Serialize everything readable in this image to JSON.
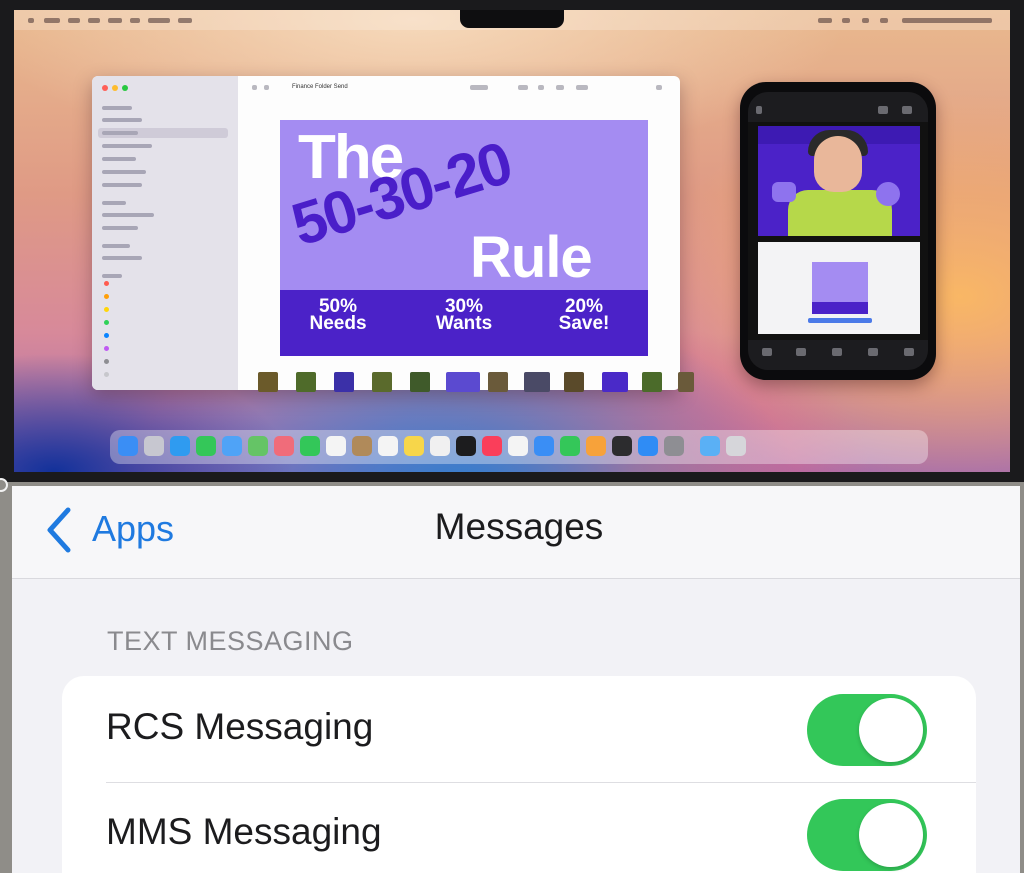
{
  "mac": {
    "finder_window_title": "Finance Folder Send",
    "poster": {
      "line1": "The",
      "line2": "50-30-20",
      "line3": "Rule",
      "splits": [
        {
          "pct": "50%",
          "label": "Needs"
        },
        {
          "pct": "30%",
          "label": "Wants"
        },
        {
          "pct": "20%",
          "label": "Save!"
        }
      ]
    },
    "colors": {
      "poster_bg": "#a48cf2",
      "poster_band": "#4b22c8",
      "poster_accent": "#4a1ec9"
    }
  },
  "ios_settings": {
    "nav": {
      "back_label": "Apps",
      "title": "Messages"
    },
    "section_header": "TEXT MESSAGING",
    "rows": [
      {
        "label": "RCS Messaging",
        "toggle_on": true
      },
      {
        "label": "MMS Messaging",
        "toggle_on": true
      }
    ],
    "colors": {
      "toggle_on": "#33c759",
      "link_blue": "#1f7ae0"
    }
  }
}
